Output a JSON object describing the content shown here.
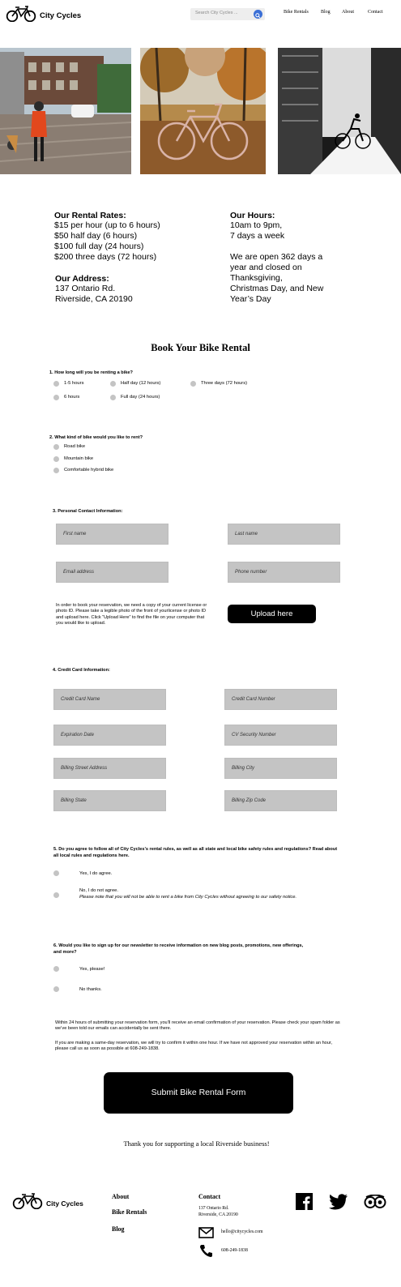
{
  "header": {
    "brand": "City Cycles",
    "search_placeholder": "Search City Cycles ...",
    "nav": [
      "Bike Rentals",
      "Blog",
      "About",
      "Contact"
    ]
  },
  "info": {
    "rates_heading": "Our Rental Rates:",
    "rates": [
      "$15 per hour (up to 6 hours)",
      "$50 half day (6 hours)",
      "$100 full day (24 hours)",
      "$200 three days (72 hours)"
    ],
    "address_heading": "Our Address:",
    "address": [
      "137 Ontario Rd.",
      "Riverside, CA 20190"
    ],
    "hours_heading": "Our Hours:",
    "hours": [
      "10am to 9pm,",
      "7 days a week"
    ],
    "open_note": [
      "We are open 362 days a",
      "year and closed on",
      "Thanksgiving,",
      "Christmas Day, and New",
      "Year’s Day"
    ]
  },
  "form": {
    "title": "Book Your Bike Rental",
    "q1": "1. How long will you be renting a bike?",
    "q1_options": [
      "1-5 hours",
      "Half day (12 hours)",
      "Three days (72 hours)",
      "6 hours",
      "Full day (24 hours)"
    ],
    "q2": "2. What kind of bike would you like to rent?",
    "q2_options": [
      "Road bike",
      "Mountain bike",
      "Comfortable hybrid bike"
    ],
    "q3": "3. Personal Contact Information:",
    "contact_fields": [
      "First name",
      "Last name",
      "Email address",
      "Phone number"
    ],
    "upload_text": "In order to book your reservation, we need a copy of your current license or photo ID. Please take a legible photo of the front of yourlicense or photo ID and upload here. Click “Upload Here” to find the file on your computer that you would like to upload.",
    "upload_button": "Upload here",
    "q4": "4. Credit Card Information:",
    "card_fields": [
      "Credit Card Name",
      "Credit Card Number",
      "Expiration Date",
      "CV Security Number",
      "Billing Street Address",
      "Billing City",
      "Billing State",
      "Billing Zip Code"
    ],
    "q5": "5. Do you agree to follow all of City Cycles’s rental rules, as well as all state and local bike safety rules and regulations? Read about all local rules and regulations here.",
    "q5_yes": "Yes, I do agree.",
    "q5_no": "No, I do not agree.",
    "q5_note": "Please note that you will not be able to rent a bike from City Cycles without agreeing to our safety notice.",
    "q6": "6. Would you like to sign up for our newsletter to receive information on new blog posts, promotions, new offerings, and more?",
    "q6_options": [
      "Yes, please!",
      "No thanks."
    ],
    "confirm_1": "Within 24 hours of submitting your reservation form, you’ll receive an email confirmation of your reservation. Please check your spam folder as we’ve been told our emails can accidentally be sent there.",
    "confirm_2": "If you are making a same-day reservation, we will try to confirm it within one hour. If we have not approved your reservation within an hour, please call us as soon as possible at 608-249-1838.",
    "submit": "Submit Bike Rental Form",
    "thanks": "Thank you for supporting a local Riverside business!"
  },
  "footer": {
    "brand": "City Cycles",
    "links": [
      "About",
      "Bike Rentals",
      "Blog"
    ],
    "contact_heading": "Contact",
    "address": [
      "137 Ontario Rd.",
      "Riverside, CA 20190"
    ],
    "email": "hello@citycycles.com",
    "phone": "608-249-1838"
  },
  "icons": [
    "bicycle-logo-icon",
    "search-icon",
    "mail-icon",
    "phone-icon",
    "facebook-icon",
    "twitter-icon",
    "tripadvisor-icon"
  ],
  "colors": {
    "search_button": "#3b6fd6",
    "field": "#c4c4c4",
    "button": "#000000"
  }
}
